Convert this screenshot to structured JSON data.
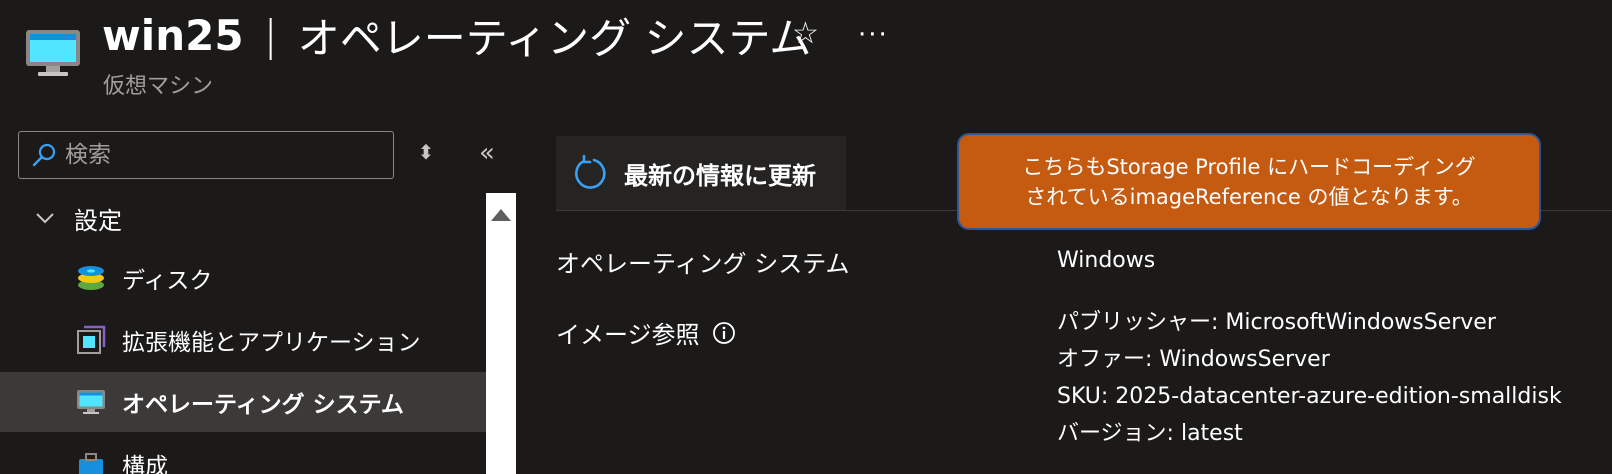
{
  "header": {
    "vm_name": "win25",
    "separator": "|",
    "page_title": "オペレーティング システム",
    "subtitle": "仮想マシン"
  },
  "search": {
    "placeholder": "検索"
  },
  "nav": {
    "group_label": "設定",
    "items": [
      {
        "label": "ディスク",
        "icon": "disk-icon"
      },
      {
        "label": "拡張機能とアプリケーション",
        "icon": "extensions-icon"
      },
      {
        "label": "オペレーティング システム",
        "icon": "monitor-icon",
        "active": true
      },
      {
        "label": "構成",
        "icon": "config-icon"
      }
    ]
  },
  "toolbar": {
    "refresh_label": "最新の情報に更新"
  },
  "callout": {
    "line1": "こちらもStorage Profile にハードコーディング",
    "line2": "されているimageReference の値となります。"
  },
  "properties": {
    "os_label": "オペレーティング システム",
    "os_value": "Windows",
    "image_ref_label": "イメージ参照",
    "image_ref": {
      "publisher": "パブリッシャー: MicrosoftWindowsServer",
      "offer": "オファー: WindowsServer",
      "sku": "SKU: 2025-datacenter-azure-edition-smalldisk",
      "version": "バージョン: latest"
    }
  },
  "colors": {
    "background": "#1b1a19",
    "callout_fill": "#c55a11",
    "callout_border": "#2f5597",
    "active_row": "#3b3a39",
    "accent_blue": "#3aa0f3"
  }
}
